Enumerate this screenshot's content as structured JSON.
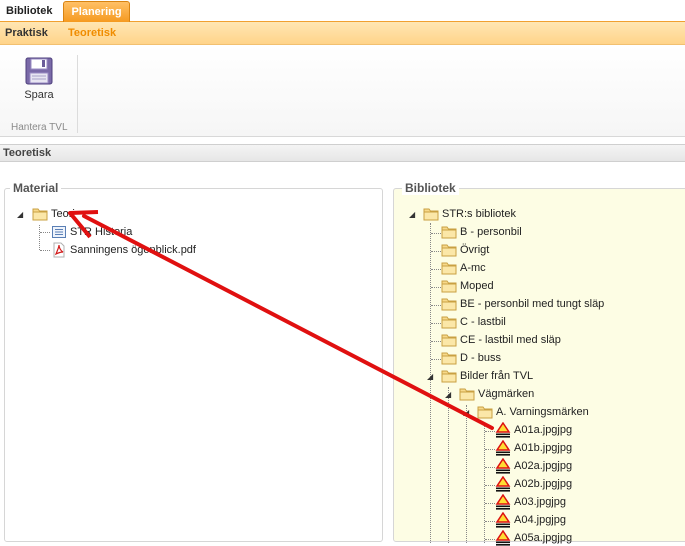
{
  "top_tabs": {
    "bibliotek": "Bibliotek",
    "planering": "Planering"
  },
  "sub_tabs": {
    "praktisk": "Praktisk",
    "teoretisk": "Teoretisk"
  },
  "ribbon": {
    "save_label": "Spara",
    "group_label": "Hantera TVL"
  },
  "section_title": "Teoretisk",
  "material": {
    "title": "Material",
    "root": "Teori",
    "children": [
      "STR Historia",
      "Sanningens ögonblick.pdf"
    ]
  },
  "bibliotek": {
    "title": "Bibliotek",
    "root": "STR:s bibliotek",
    "folders": [
      "B - personbil",
      "Övrigt",
      "A-mc",
      "Moped",
      "BE - personbil med tungt släp",
      "C - lastbil",
      "CE - lastbil med släp",
      "D - buss",
      "Bilder från TVL"
    ],
    "vagmarken": "Vägmärken",
    "varningsmarken": "A. Varningsmärken",
    "files": [
      "A01a.jpgjpg",
      "A01b.jpgjpg",
      "A02a.jpgjpg",
      "A02b.jpgjpg",
      "A03.jpgjpg",
      "A04.jpgjpg",
      "A05a.jpgjpg"
    ]
  },
  "colors": {
    "accent": "#f59a20",
    "arrow": "#e01010",
    "library_bg": "#fdfde4"
  }
}
